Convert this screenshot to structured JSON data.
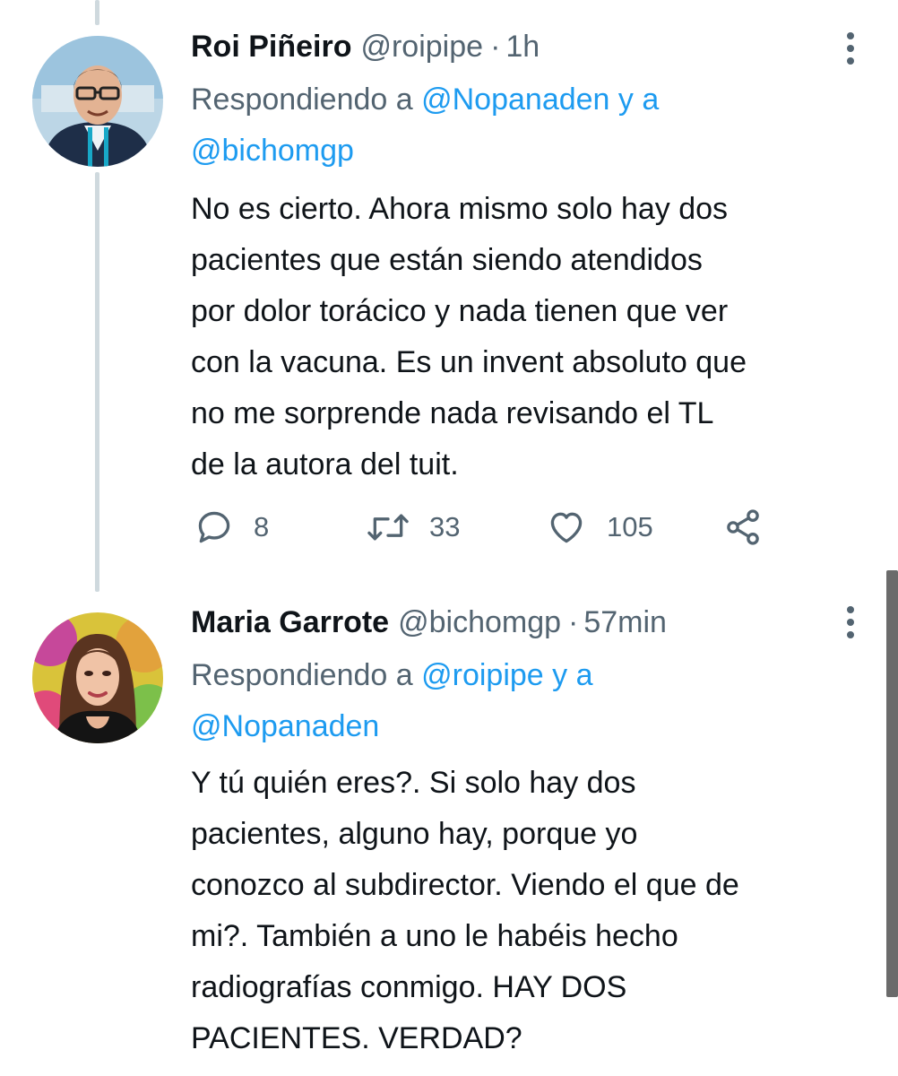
{
  "colors": {
    "text": "#0f1419",
    "secondary": "#536471",
    "accent": "#1d9bf0",
    "thread_line": "#cfd9de",
    "scrollbar": "#6b6b6b"
  },
  "tweets": [
    {
      "display_name": "Roi Piñeiro",
      "handle": "@roipipe",
      "separator": "·",
      "time": "1h",
      "replying_prefix": "Respondiendo a",
      "replying_mention_1": "@Nopanaden",
      "replying_conjunction": "y a",
      "replying_mention_2": "@bichomgp",
      "text_lines": [
        "No es cierto. Ahora mismo solo hay dos",
        "pacientes que están siendo atendidos",
        "por dolor torácico y nada tienen que ver",
        "con la vacuna. Es un invent absoluto que",
        "no me sorprende nada revisando el TL",
        "de la autora del tuit."
      ],
      "actions": {
        "replies": "8",
        "retweets": "33",
        "likes": "105",
        "reply_icon": "reply-icon",
        "retweet_icon": "retweet-icon",
        "like_icon": "heart-icon",
        "share_icon": "share-icon"
      }
    },
    {
      "display_name": "Maria Garrote",
      "handle": "@bichomgp",
      "separator": "·",
      "time": "57min",
      "replying_prefix": "Respondiendo a",
      "replying_mention_1": "@roipipe",
      "replying_conjunction": "y a",
      "replying_mention_2": "@Nopanaden",
      "text_lines": [
        "Y tú quién eres?. Si solo hay dos",
        "pacientes, alguno hay, porque yo",
        "conozco al subdirector. Viendo el que de",
        "mi?. También a uno le habéis hecho",
        "radiografías conmigo. HAY DOS",
        "PACIENTES. VERDAD?"
      ]
    }
  ]
}
